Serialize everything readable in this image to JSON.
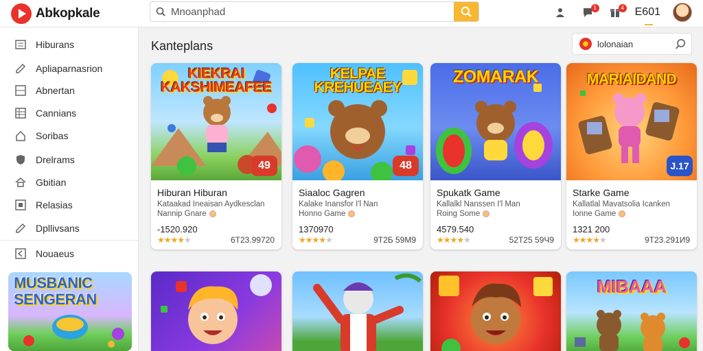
{
  "app": {
    "name": "Abkopkale"
  },
  "search": {
    "placeholder": "Mnoanphad"
  },
  "header": {
    "coins": "E601",
    "badge1": "1",
    "badge2": "4"
  },
  "sidebar": {
    "items": [
      {
        "label": "Hiburans",
        "icon": "list-icon"
      },
      {
        "label": "Apliaparnasrion",
        "icon": "edit-icon"
      },
      {
        "label": "Abnertan",
        "icon": "grid-icon"
      },
      {
        "label": "Cannians",
        "icon": "table-icon"
      },
      {
        "label": "Soribas",
        "icon": "house-icon"
      },
      {
        "label": "Drelrams",
        "icon": "shield-icon"
      },
      {
        "label": "Gbitian",
        "icon": "home-icon"
      },
      {
        "label": "Relasias",
        "icon": "square-icon"
      },
      {
        "label": "Dpllivsans",
        "icon": "edit-icon"
      },
      {
        "label": "Nouaeus",
        "icon": "back-icon"
      }
    ],
    "promo_title": "MUSBANIC SENGERAN"
  },
  "main": {
    "section_title": "Kanteplans",
    "filter_label": "lolonaian"
  },
  "cards": [
    {
      "art_title": "KIEKRAI KAKSHIMEAFEE",
      "badge": "49",
      "name": "Hiburan Hiburan",
      "desc": "Kataakad Ineaisan Aydkesclan",
      "desc2": "Nannip Gnare",
      "number": "-1520.920",
      "rating": 4,
      "count": "6Т23.99720"
    },
    {
      "art_title": "KELPAE KREHUEAEY",
      "badge": "48",
      "name": "Siaaloc Gagren",
      "desc": "Kalake Inansfor I'l Nan",
      "desc2": "Honno Game",
      "number": "1370970",
      "rating": 4,
      "count": "9Т2Б 59М9"
    },
    {
      "art_title": "ZOMARAK",
      "badge": "",
      "name": "Spukatk Game",
      "desc": "Kallalkl Nanssen I'l Man",
      "desc2": "Roing Some",
      "number": "4579.540",
      "rating": 4,
      "count": "52Т25 59Ч9"
    },
    {
      "art_title": "MARIAIDAND",
      "badge": "J.17",
      "name": "Starke Game",
      "desc": "Kallatlal Mavatsolia Icanken",
      "desc2": "Ionne Game",
      "number": "1321 200",
      "rating": 4,
      "count": "9Т23.291И9"
    }
  ],
  "row2": [
    {
      "art_title": ""
    },
    {
      "art_title": ""
    },
    {
      "art_title": ""
    },
    {
      "art_title": "MIBAAA"
    }
  ],
  "colors": {
    "accent": "#f7b731",
    "brand": "#e8322b"
  }
}
